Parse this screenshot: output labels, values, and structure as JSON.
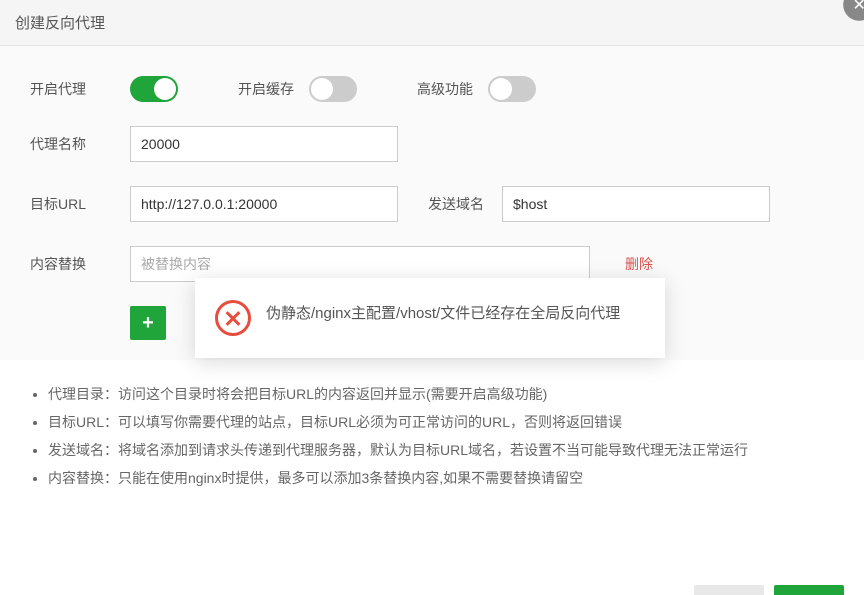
{
  "dialog": {
    "title": "创建反向代理"
  },
  "toggles": {
    "enable_proxy": {
      "label": "开启代理",
      "value": true
    },
    "enable_cache": {
      "label": "开启缓存",
      "value": false
    },
    "advanced": {
      "label": "高级功能",
      "value": false
    }
  },
  "fields": {
    "proxy_name": {
      "label": "代理名称",
      "value": "20000"
    },
    "target_url": {
      "label": "目标URL",
      "value": "http://127.0.0.1:20000"
    },
    "send_domain": {
      "label": "发送域名",
      "value": "$host"
    },
    "content_replace": {
      "label": "内容替换",
      "placeholder": "被替换内容",
      "delete": "删除"
    }
  },
  "popup": {
    "message": "伪静态/nginx主配置/vhost/文件已经存在全局反向代理"
  },
  "help": [
    {
      "key": "代理目录：",
      "text": "访问这个目录时将会把目标URL的内容返回并显示(需要开启高级功能)"
    },
    {
      "key": "目标URL：",
      "text": "可以填写你需要代理的站点，目标URL必须为可正常访问的URL，否则将返回错误"
    },
    {
      "key": "发送域名：",
      "text": "将域名添加到请求头传递到代理服务器，默认为目标URL域名，若设置不当可能导致代理无法正常运行"
    },
    {
      "key": "内容替换：",
      "text": "只能在使用nginx时提供，最多可以添加3条替换内容,如果不需要替换请留空"
    }
  ]
}
